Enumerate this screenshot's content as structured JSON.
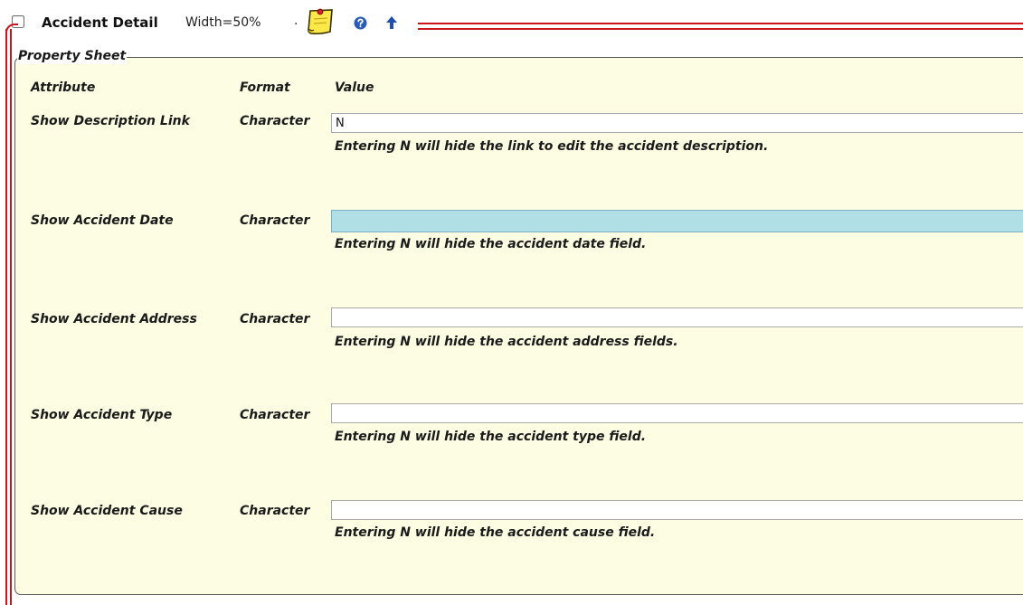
{
  "header": {
    "title": "Accident Detail",
    "width_label": "Width=50%",
    "separator": ".",
    "icons": [
      "sticky-note-icon",
      "help-icon",
      "up-arrow-icon"
    ],
    "accent_color": "#c9151e"
  },
  "sheet": {
    "legend": "Property Sheet",
    "background": "#fdfde4",
    "columns": {
      "attribute": "Attribute",
      "format": "Format",
      "value": "Value"
    },
    "rows": [
      {
        "attribute": "Show Description Link",
        "format": "Character",
        "value": "N",
        "hint_prefix": "Entering ",
        "hint_key": "N",
        "hint_suffix": " will hide the link to edit the accident description."
      },
      {
        "attribute": "Show Accident Date",
        "format": "Character",
        "value": "",
        "focused": true,
        "hint_prefix": "Entering ",
        "hint_key": "N",
        "hint_suffix": " will hide the accident date field."
      },
      {
        "attribute": "Show Accident Address",
        "format": "Character",
        "value": "",
        "hint_prefix": "Entering ",
        "hint_key": "N",
        "hint_suffix": " will hide the accident address fields."
      },
      {
        "attribute": "Show Accident Type",
        "format": "Character",
        "value": "",
        "hint_prefix": "Entering ",
        "hint_key": "N",
        "hint_suffix": " will hide the accident type field."
      },
      {
        "attribute": "Show Accident Cause",
        "format": "Character",
        "value": "",
        "hint_prefix": "Entering ",
        "hint_key": "N",
        "hint_suffix": " will hide the accident cause field."
      }
    ]
  }
}
